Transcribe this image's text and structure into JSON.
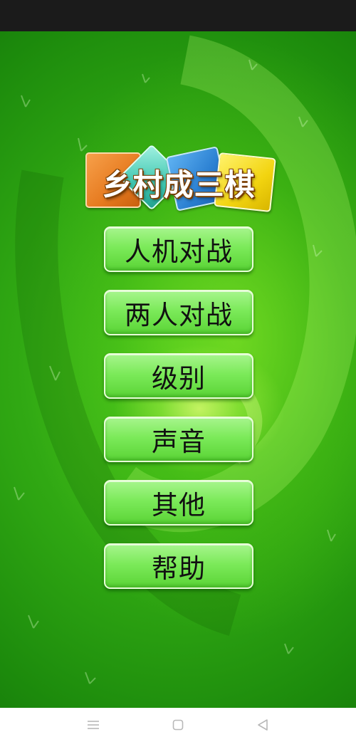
{
  "game": {
    "title": "乡村成三棋",
    "menu": [
      {
        "label": "人机对战"
      },
      {
        "label": "两人对战"
      },
      {
        "label": "级别"
      },
      {
        "label": "声音"
      },
      {
        "label": "其他"
      },
      {
        "label": "帮助"
      }
    ]
  },
  "colors": {
    "background": "#2ea512",
    "button": "#7cea5a",
    "status_bar": "#1b1b1b",
    "nav_bar": "#ffffff"
  },
  "nav_bar": {
    "icons": [
      "menu-icon",
      "home-icon",
      "back-icon"
    ]
  }
}
